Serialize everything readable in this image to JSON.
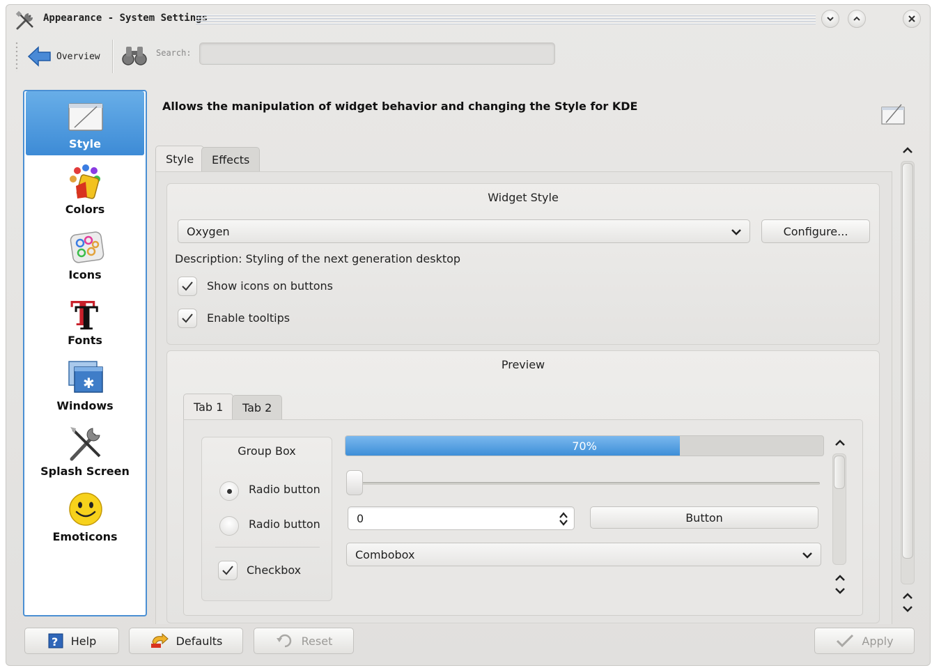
{
  "window": {
    "title": "Appearance - System Settings"
  },
  "toolbar": {
    "overview_label": "Overview",
    "search_label": "Search:",
    "search_value": ""
  },
  "sidebar": {
    "items": [
      {
        "label": "Style",
        "icon": "style-icon",
        "selected": true
      },
      {
        "label": "Colors",
        "icon": "colors-icon",
        "selected": false
      },
      {
        "label": "Icons",
        "icon": "icons-icon",
        "selected": false
      },
      {
        "label": "Fonts",
        "icon": "fonts-icon",
        "selected": false
      },
      {
        "label": "Windows",
        "icon": "windows-icon",
        "selected": false
      },
      {
        "label": "Splash Screen",
        "icon": "splash-screen-icon",
        "selected": false
      },
      {
        "label": "Emoticons",
        "icon": "emoticons-icon",
        "selected": false
      }
    ],
    "accent_color": "#3d8bd6"
  },
  "main": {
    "headline": "Allows the manipulation of widget behavior and changing the Style for KDE",
    "tabs": [
      {
        "label": "Style",
        "active": true
      },
      {
        "label": "Effects",
        "active": false
      }
    ],
    "widget_style": {
      "title": "Widget Style",
      "selected_style": "Oxygen",
      "configure_label": "Configure...",
      "description": "Description: Styling of the next generation desktop",
      "show_icons_label": "Show icons on buttons",
      "show_icons_checked": true,
      "enable_tooltips_label": "Enable tooltips",
      "enable_tooltips_checked": true
    },
    "preview": {
      "title": "Preview",
      "tabs": [
        {
          "label": "Tab 1",
          "active": true
        },
        {
          "label": "Tab 2",
          "active": false
        }
      ],
      "group_box_title": "Group Box",
      "radio1_label": "Radio button",
      "radio1_checked": true,
      "radio2_label": "Radio button",
      "radio2_checked": false,
      "checkbox_label": "Checkbox",
      "checkbox_checked": true,
      "progress_text": "70%",
      "progress_value": 0.7,
      "slider_value": 0,
      "spin_value": "0",
      "button_label": "Button",
      "combobox_value": "Combobox"
    }
  },
  "buttons": {
    "help": "Help",
    "defaults": "Defaults",
    "reset": "Reset",
    "apply": "Apply"
  }
}
